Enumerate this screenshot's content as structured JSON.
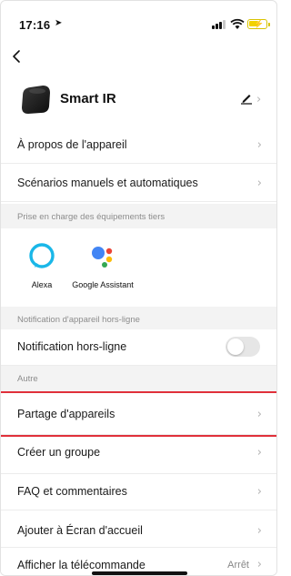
{
  "status": {
    "time": "17:16"
  },
  "device": {
    "name": "Smart IR"
  },
  "menu": {
    "about": "À propos de l'appareil",
    "scenarios": "Scénarios manuels et automatiques",
    "third_party_header": "Prise en charge des équipements tiers",
    "assistants": [
      {
        "name": "Alexa"
      },
      {
        "name": "Google Assistant"
      }
    ],
    "offline_header": "Notification d'appareil hors-ligne",
    "offline_label": "Notification hors-ligne",
    "offline_enabled": false,
    "other_header": "Autre",
    "share": "Partage d'appareils",
    "group": "Créer un groupe",
    "faq": "FAQ et commentaires",
    "home_screen": "Ajouter à Écran d'accueil",
    "remote_label": "Afficher la télécommande",
    "remote_value": "Arrêt"
  },
  "colors": {
    "highlight": "#e0303a",
    "alexa": "#1ab7e8"
  }
}
